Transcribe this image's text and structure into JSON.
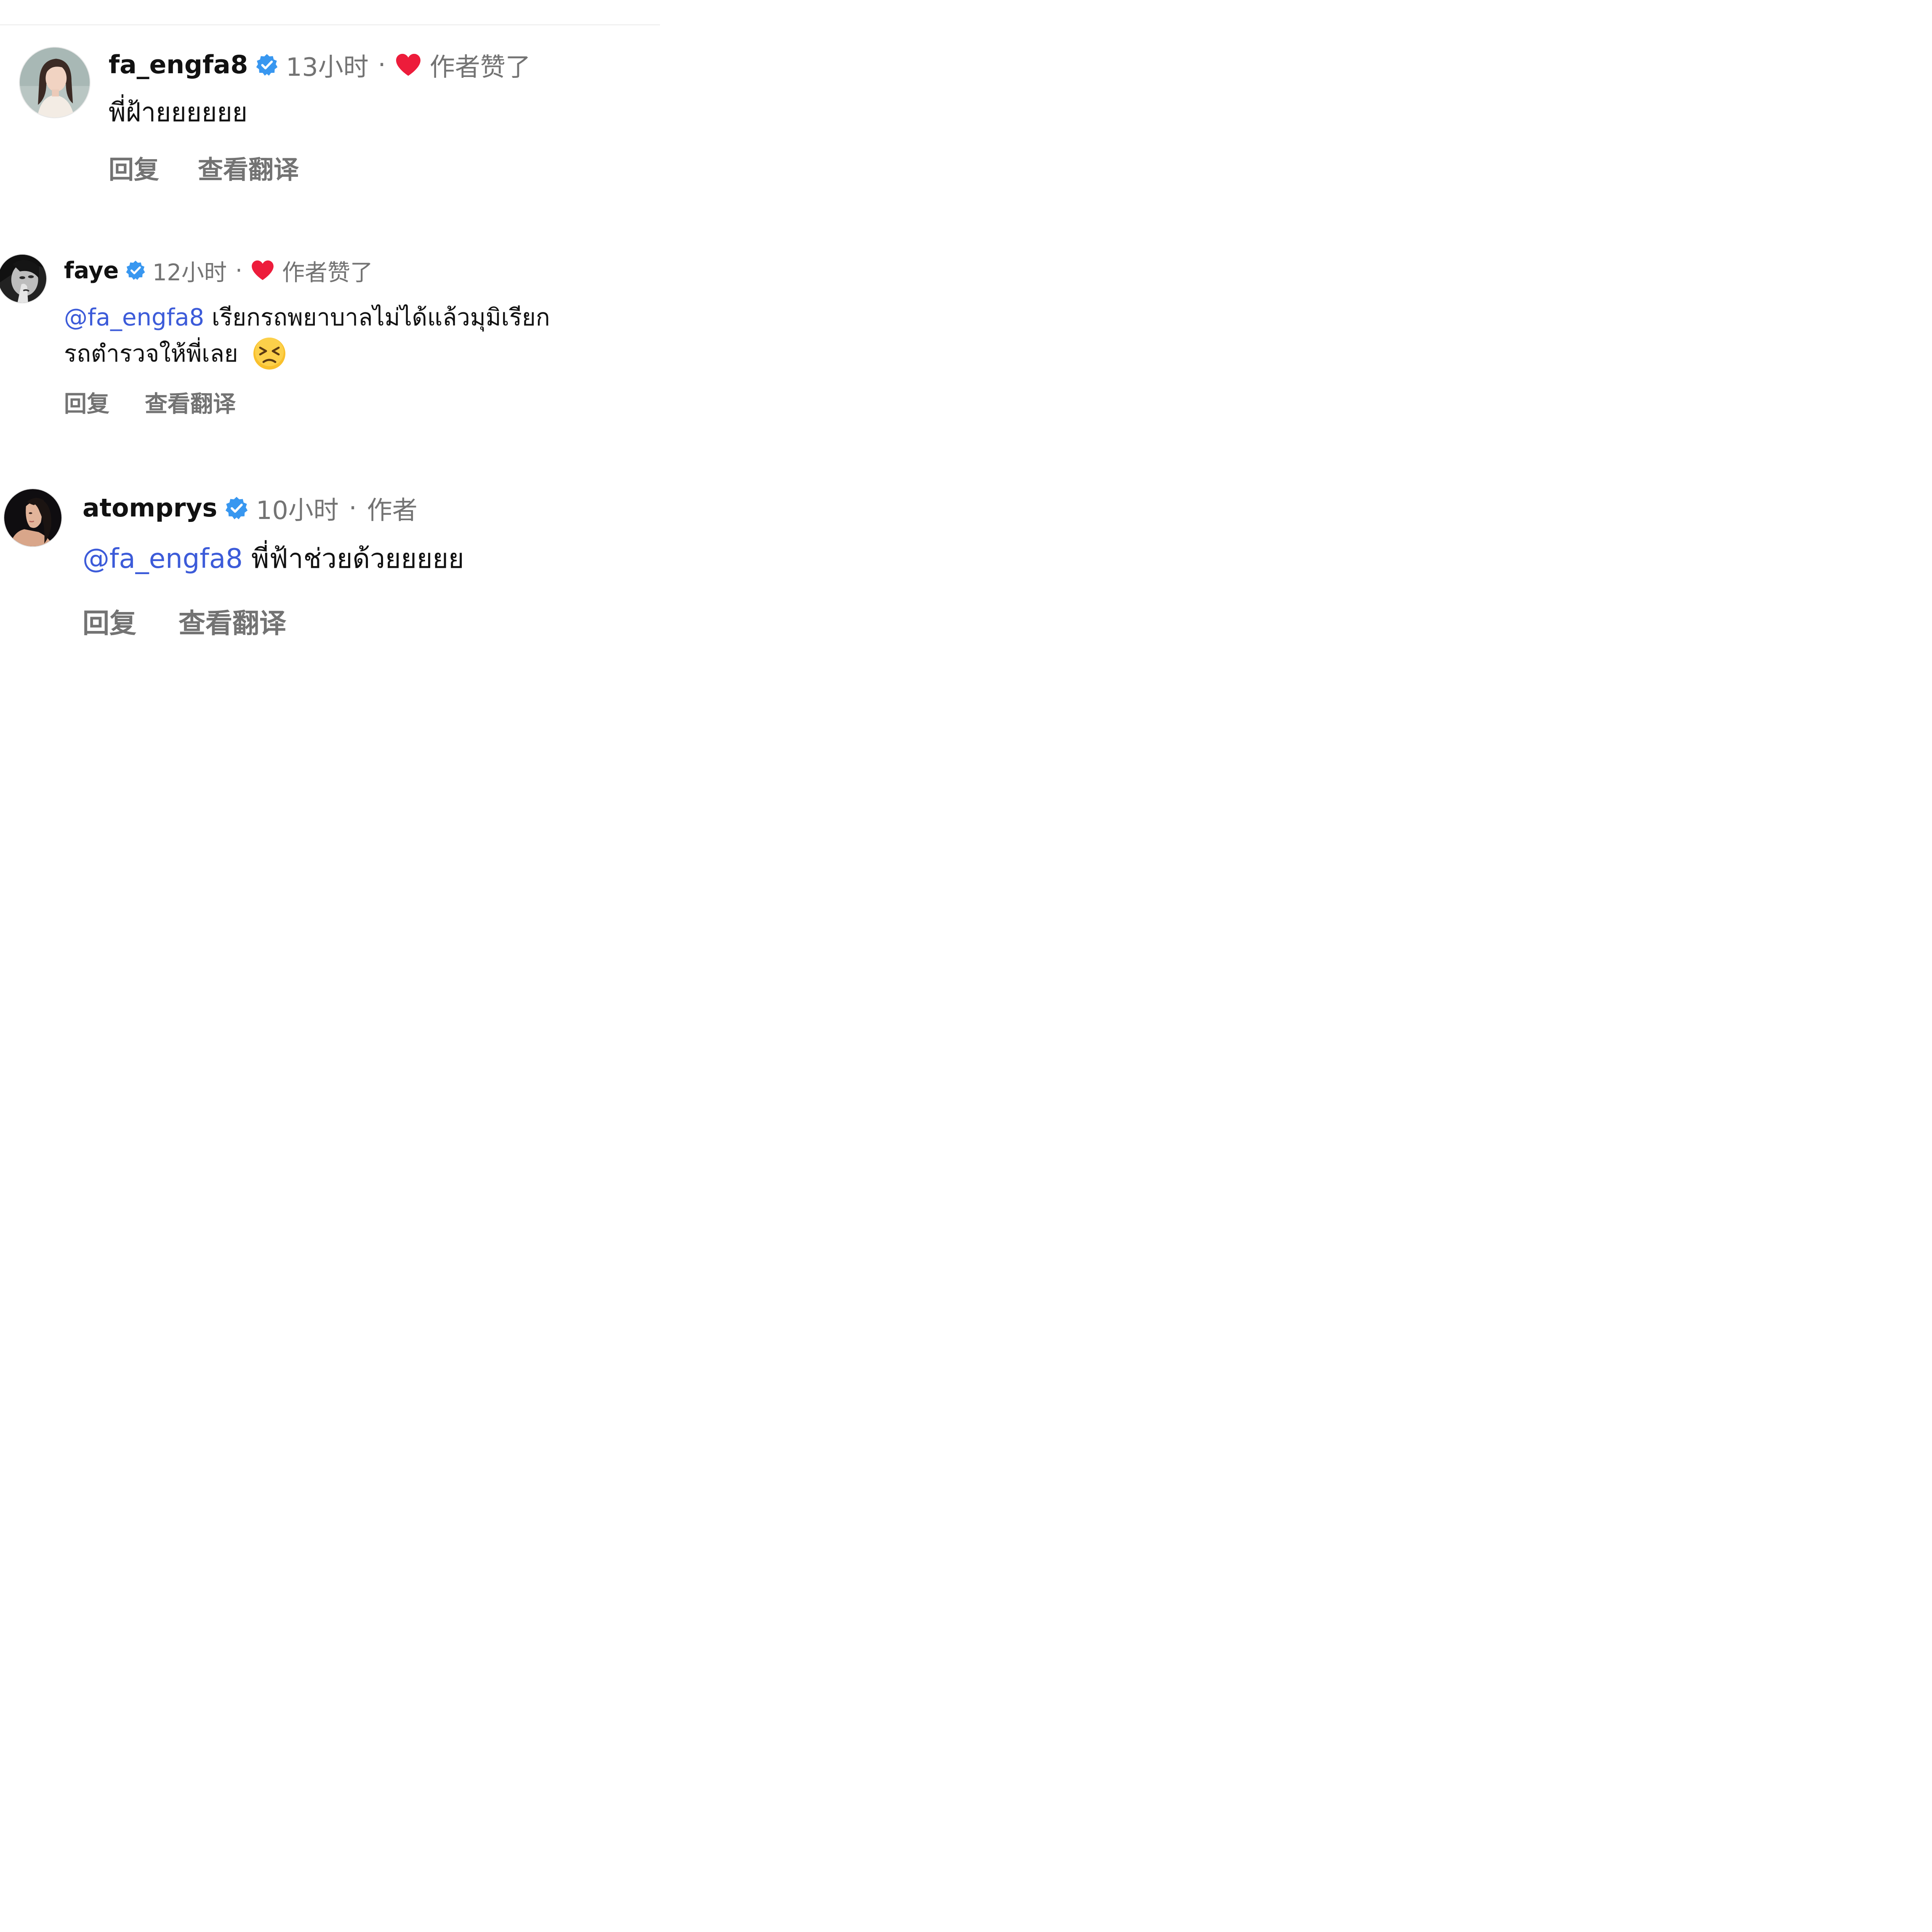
{
  "comments": [
    {
      "username": "fa_engfa8",
      "time": "13小时",
      "separator": "·",
      "liked_label": "作者赞了",
      "text": "พี่ฝ้ายยยยยย",
      "mention": "",
      "reply_label": "回复",
      "translate_label": "查看翻译"
    },
    {
      "username": "faye",
      "time": "12小时",
      "separator": "·",
      "liked_label": "作者赞了",
      "mention": "@fa_engfa8",
      "text": " เรียกรถพยาบาลไม่ได้แล้วมุมิเรียก",
      "text_line2": "รถตำรวจให้พี่เลย",
      "emoji": "persevering-face-emoji",
      "reply_label": "回复",
      "translate_label": "查看翻译"
    },
    {
      "username": "atomprys",
      "time": "10小时",
      "separator": "·",
      "author_label": "作者",
      "mention": "@fa_engfa8",
      "text": " พี่ฟ้าช่วยด้วยยยยย",
      "reply_label": "回复",
      "translate_label": "查看翻译"
    }
  ],
  "colors": {
    "mention": "#3c5bd9",
    "meta": "#737373",
    "heart": "#ed1c3b",
    "verified": "#3897f0"
  }
}
